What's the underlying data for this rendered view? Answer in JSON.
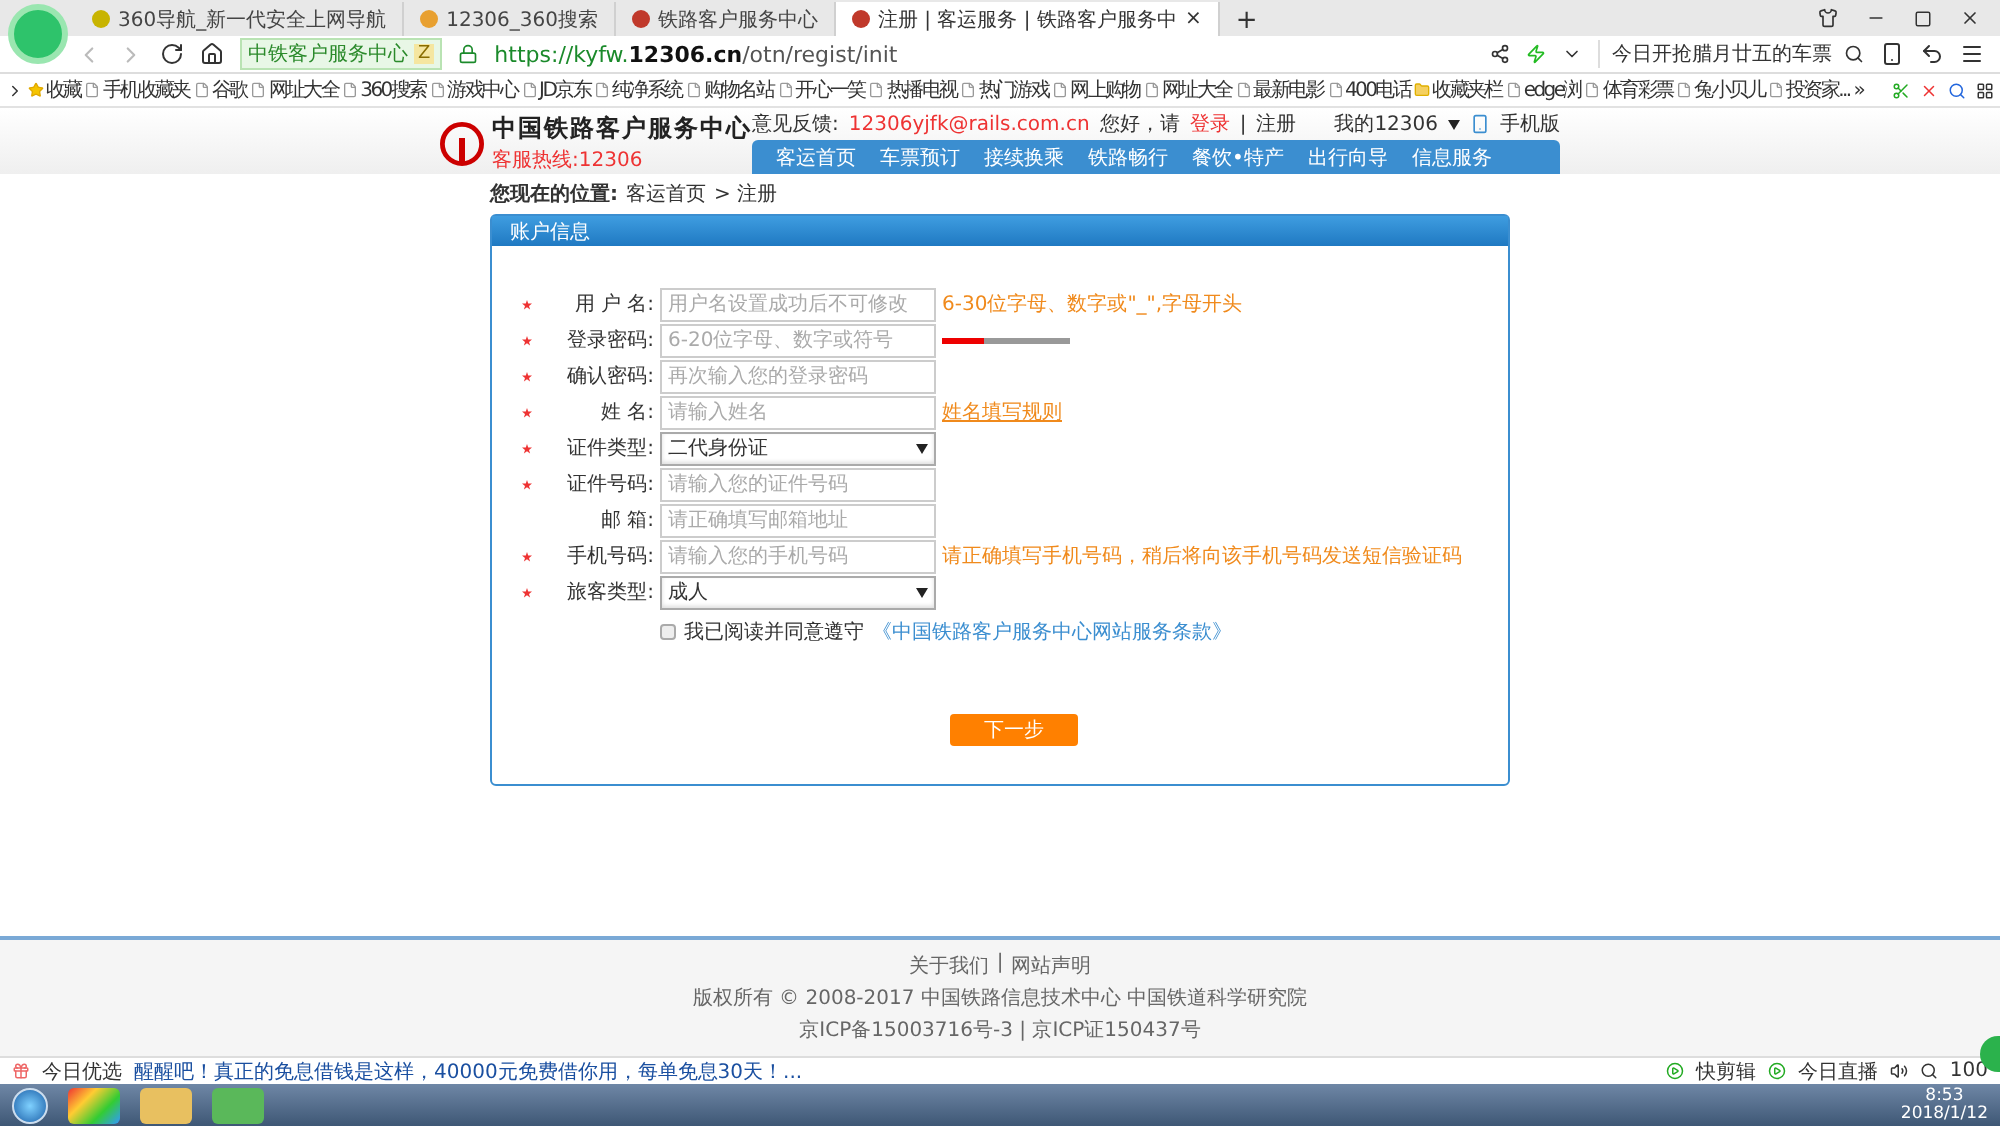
{
  "browser": {
    "tabs": [
      {
        "title": "360导航_新一代安全上网导航",
        "selected": false
      },
      {
        "title": "12306_360搜索",
        "selected": false
      },
      {
        "title": "铁路客户服务中心",
        "selected": false
      },
      {
        "title": "注册 | 客运服务 | 铁路客户服务中",
        "selected": true,
        "close": "×"
      }
    ],
    "new_tab": "+",
    "site_badge": "中铁客户服务中心",
    "site_badge_tag": "Z",
    "url_prefix": "https://kyfw.",
    "url_domain": "12306.cn",
    "url_path": "/otn/regist/init",
    "search_placeholder": "今日开抢腊月廿五的车票",
    "bookmarks": [
      "收藏",
      "手机收藏夹",
      "谷歌",
      "网址大全",
      "360搜索",
      "游戏中心",
      "JD京东",
      "纯净系统",
      "购物名站",
      "开心一笑",
      "热播电视",
      "热门游戏",
      "网上购物",
      "网址大全",
      "最新电影",
      "400电话",
      "收藏夹栏",
      "edge浏",
      "体育彩票",
      "兔小贝儿",
      "投资家..."
    ],
    "bookmarks_more": "»"
  },
  "site_header": {
    "title": "中国铁路客户服务中心",
    "hotline": "客服热线:12306",
    "feedback_label": "意见反馈:",
    "feedback_email": "12306yjfk@rails.com.cn",
    "greeting": "您好，请",
    "login": "登录",
    "separator": "|",
    "register": "注册",
    "my12306": "我的12306",
    "mobile": "手机版",
    "nav": [
      "客运首页",
      "车票预订",
      "接续换乘",
      "铁路畅行",
      "餐饮•特产",
      "出行向导",
      "信息服务"
    ]
  },
  "breadcrumb": {
    "label": "您现在的位置:",
    "home": "客运首页",
    "current": "> 注册"
  },
  "panel": {
    "title": "账户信息",
    "rows": [
      {
        "label": "用 户 名:",
        "required": true,
        "kind": "input",
        "placeholder": "用户名设置成功后不可修改",
        "hint": {
          "kind": "text",
          "text": "6-30位字母、数字或\"_\",字母开头"
        }
      },
      {
        "label": "登录密码:",
        "required": true,
        "kind": "input",
        "placeholder": "6-20位字母、数字或符号",
        "hint": {
          "kind": "strength",
          "level": 0.33
        }
      },
      {
        "label": "确认密码:",
        "required": true,
        "kind": "input",
        "placeholder": "再次输入您的登录密码"
      },
      {
        "label": "姓 名:",
        "required": true,
        "kind": "input",
        "placeholder": "请输入姓名",
        "hint": {
          "kind": "link",
          "text": "姓名填写规则"
        }
      },
      {
        "label": "证件类型:",
        "required": true,
        "kind": "select",
        "value": "二代身份证"
      },
      {
        "label": "证件号码:",
        "required": true,
        "kind": "input",
        "placeholder": "请输入您的证件号码"
      },
      {
        "label": "邮 箱:",
        "required": false,
        "kind": "input",
        "placeholder": "请正确填写邮箱地址"
      },
      {
        "label": "手机号码:",
        "required": true,
        "kind": "input",
        "placeholder": "请输入您的手机号码",
        "hint": {
          "kind": "text",
          "text": "请正确填写手机号码，稍后将向该手机号码发送短信验证码"
        }
      },
      {
        "label": "旅客类型:",
        "required": true,
        "kind": "select",
        "value": "成人"
      }
    ],
    "agree": {
      "checked": false,
      "text": "我已阅读并同意遵守",
      "link": "《中国铁路客户服务中心网站服务条款》"
    },
    "next_button": "下一步"
  },
  "footer": {
    "links": [
      "关于我们",
      "网站声明"
    ],
    "separator": "|",
    "copyright": "版权所有 © 2008-2017 中国铁路信息技术中心 中国铁道科学研究院",
    "icp": "京ICP备15003716号-3 | 京ICP证150437号"
  },
  "status_bar": {
    "label": "今日优选",
    "news": "醒醒吧！真正的免息借钱是这样，40000元免费借你用，每单免息30天！...",
    "tools": [
      "快剪辑",
      "今日直播"
    ],
    "zoom": "100"
  },
  "taskbar": {
    "time": "8:53",
    "date": "2018/1/12"
  }
}
